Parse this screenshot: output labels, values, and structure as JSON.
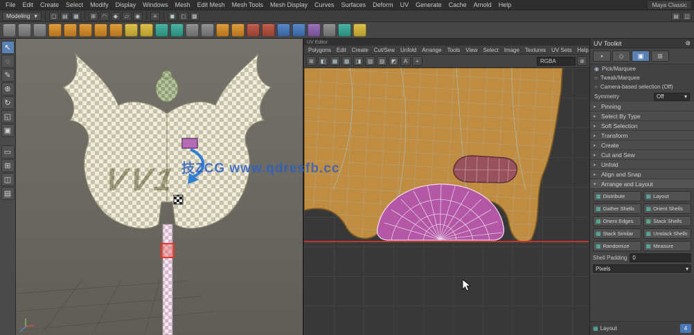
{
  "palette": {
    "accent_blue": "#5a82b4",
    "teal": "#5bc0b0",
    "uv_shell_tan": "#c08c42",
    "uv_shell_magenta": "#b357a6",
    "uv_shell_maroon": "#97525c",
    "selection_red": "#e2372c",
    "uv_baseline_red": "#bc3a30",
    "watermark_blue": "#2b5fc4"
  },
  "menubar": {
    "items": [
      "File",
      "Edit",
      "Create",
      "Select",
      "Modify",
      "Display",
      "Windows",
      "Mesh",
      "Edit Mesh",
      "Mesh Tools",
      "Mesh Display",
      "Curves",
      "Surfaces",
      "Deform",
      "UV",
      "Generate",
      "Cache",
      "Arnold",
      "Help"
    ],
    "workspace_value": "Maya Classic"
  },
  "statusbar": {
    "menu_set_value": "Modeling"
  },
  "shelf": {
    "icon_names": [
      "ep-curve",
      "pencil-curve",
      "arc-3pt",
      "nurbs-circle",
      "nurbs-square",
      "poly-sphere",
      "poly-cube",
      "poly-cylinder",
      "poly-cone",
      "poly-torus",
      "poly-plane",
      "poly-disc",
      "platonic-solid",
      "poly-pyramid",
      "poly-pipe",
      "poly-helix",
      "poly-gear",
      "soccer-ball",
      "super-ellipse",
      "spherical-harmonics",
      "ultra-shape",
      "boolean-union",
      "boolean-difference",
      "boolean-intersection"
    ]
  },
  "icons": {
    "select_tool": "↖",
    "lasso_tool": "◌",
    "paint_select": "✎",
    "move_tool": "⊕",
    "rotate_tool": "↻",
    "scale_tool": "◱",
    "last_tool": "▣",
    "layout_single": "▭",
    "layout_four": "⊞",
    "layout_split": "◫",
    "layout_outliner": "▤",
    "file_new": "▢",
    "file_open": "▤",
    "file_save": "▦",
    "snap_grid": "⊞",
    "snap_curve": "◠",
    "snap_point": "◆",
    "snap_plane": "▱",
    "make_live": "◉",
    "history": "≡",
    "render": "◼",
    "ipr": "◻",
    "render_settings": "▩",
    "uv_grid": "⊞",
    "uv_isolate": "◧",
    "uv_image": "▦",
    "uv_texture": "▩",
    "uv_shade": "◨",
    "uv_distortion": "▧",
    "uv_checker": "▨",
    "uv_channel_a": "A",
    "uv_pixel_snap": "+",
    "uv_border": "◩",
    "mode_vertex": "▪",
    "mode_edge": "◇",
    "mode_face": "▣",
    "mode_uv": "⊞",
    "radio_on": "◉",
    "radio_off": "○",
    "collapsed": "▸",
    "expanded": "▾",
    "caret": "▾",
    "gear": "⊛",
    "tk_btn": "▦"
  },
  "uv_editor": {
    "title": "UV Editor",
    "menus": [
      "Polygons",
      "Edit",
      "Create",
      "Cut/Sew",
      "Unfold",
      "Arrange",
      "Tools",
      "View",
      "Select",
      "Image",
      "Textures",
      "UV Sets",
      "Help"
    ],
    "toolbar": {
      "channel_value": "RGBA"
    }
  },
  "uv_toolkit": {
    "title": "UV Toolkit",
    "rows": {
      "pick": "Pick/Marquee",
      "tweak": "Tweak/Marquee",
      "camera": "Camera-based selection (Off)"
    },
    "symmetry_label": "Symmetry",
    "symmetry_value": "Off",
    "sections": [
      {
        "label": "Pinning"
      },
      {
        "label": "Select By Type"
      },
      {
        "label": "Soft Selection"
      },
      {
        "label": "Transform"
      },
      {
        "label": "Create"
      },
      {
        "label": "Cut and Sew"
      },
      {
        "label": "Unfold"
      },
      {
        "label": "Align and Snap"
      }
    ],
    "arrange": {
      "label": "Arrange and Layout",
      "big_buttons": [
        "Distribute",
        "Layout"
      ],
      "buttons": [
        "Gather Shells",
        "Orient Shells",
        "Orient Edges",
        "Stack Shells",
        "Stack Similar",
        "Unstack Shells",
        "Randomize",
        "Measure"
      ],
      "padding_label": "Shell Padding",
      "padding_value": "0",
      "unit_value": "Pixels",
      "layout_button": "Layout",
      "spin_value": "4"
    }
  },
  "watermark": {
    "line": "技ZCG  www.qdresfb.cc",
    "big": "VV1"
  }
}
